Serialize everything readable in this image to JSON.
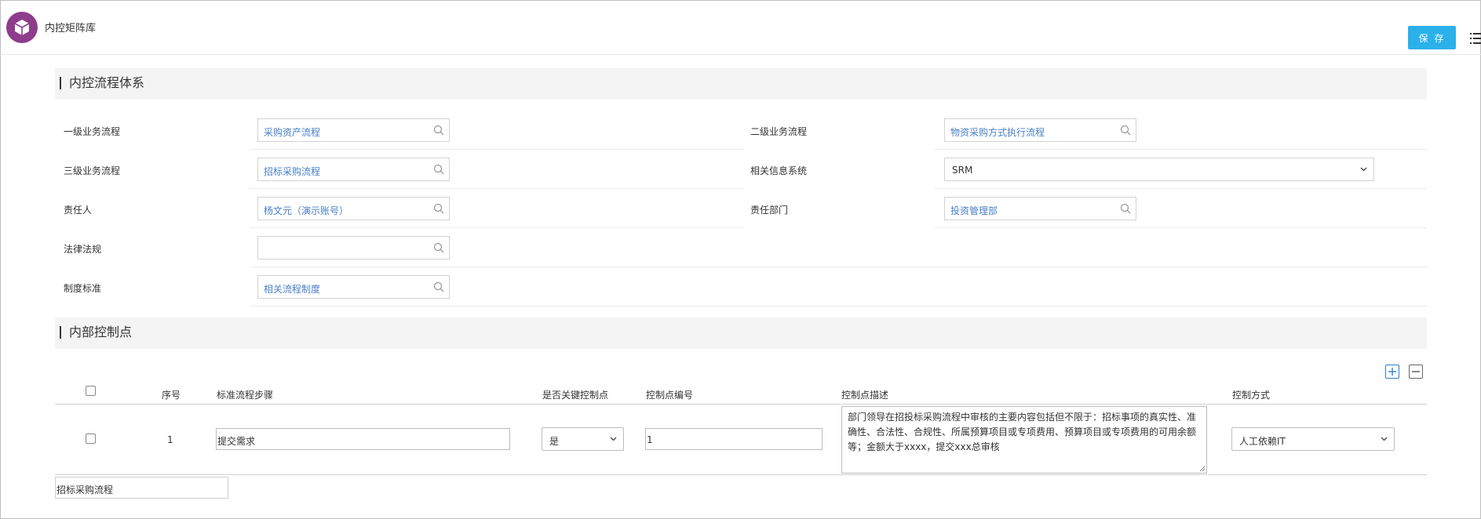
{
  "header": {
    "title": "内控矩阵库",
    "save_label": "保 存"
  },
  "sections": {
    "process_system": "内控流程体系",
    "control_points": "内部控制点"
  },
  "form": {
    "level1": {
      "label": "一级业务流程",
      "value": "采购资产流程"
    },
    "level2": {
      "label": "二级业务流程",
      "value": "物资采购方式执行流程"
    },
    "level3": {
      "label": "三级业务流程",
      "value": "招标采购流程"
    },
    "info_system": {
      "label": "相关信息系统",
      "value": "SRM"
    },
    "owner": {
      "label": "责任人",
      "value": "杨文元（演示账号）"
    },
    "department": {
      "label": "责任部门",
      "value": "投资管理部"
    },
    "laws": {
      "label": "法律法规",
      "value": ""
    },
    "standard": {
      "label": "制度标准",
      "value": "相关流程制度"
    }
  },
  "table": {
    "columns": [
      "序号",
      "标准流程步骤",
      "是否关键控制点",
      "控制点编号",
      "控制点描述",
      "控制方式"
    ],
    "rows": [
      {
        "index": "1",
        "step": "提交需求",
        "is_key": "是",
        "code": "1",
        "description": "部门领导在招投标采购流程中审核的主要内容包括但不限于：招标事项的真实性、准确性、合法性、合规性、所属预算项目或专项费用、预算项目或专项费用的可用余额等；金额大于xxxx，提交xxx总审核",
        "method": "人工依赖IT"
      }
    ]
  },
  "footer_value": "招标采购流程",
  "colors": {
    "accent": "#2bb0ea",
    "logo": "#8e3c8c",
    "link_value": "#4a7ec8",
    "table_icon": "#2f7fd0"
  }
}
